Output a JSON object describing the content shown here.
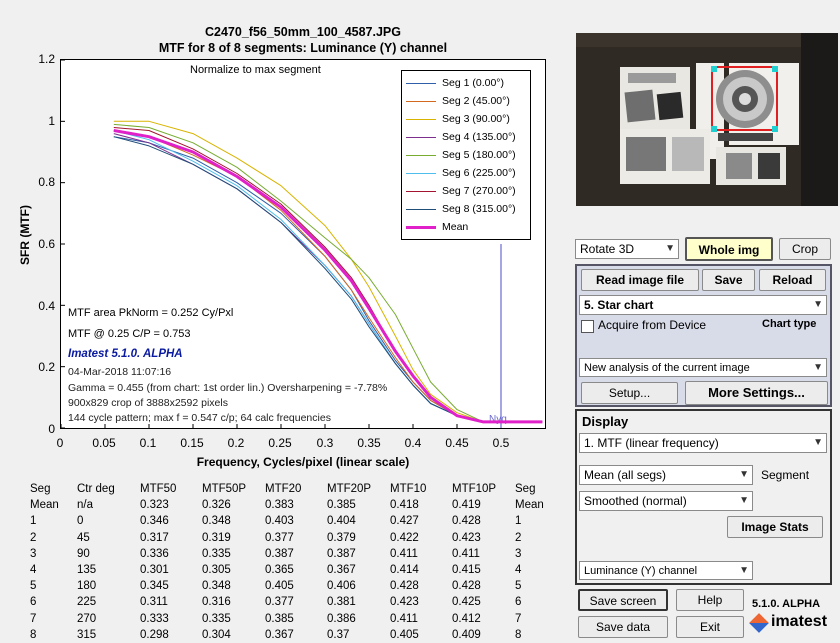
{
  "chart_data": {
    "type": "line",
    "title": "C2470_f56_50mm_100_4587.JPG",
    "subtitle": "MTF for 8 of 8 segments:  Luminance (Y) channel",
    "xlabel": "Frequency, Cycles/pixel (linear scale)",
    "ylabel": "SFR (MTF)",
    "xlim": [
      0,
      0.55
    ],
    "ylim": [
      0,
      1.2
    ],
    "x_ticks": [
      "0",
      "0.05",
      "0.1",
      "0.15",
      "0.2",
      "0.25",
      "0.3",
      "0.35",
      "0.4",
      "0.45",
      "0.5"
    ],
    "y_ticks": [
      "0",
      "0.2",
      "0.4",
      "0.6",
      "0.8",
      "1",
      "1.2"
    ],
    "top_note": "Normalize to max segment",
    "nyquist_label": "Nyq",
    "nyquist_x": 0.5,
    "legend_placement": "top-right",
    "x": [
      0.06,
      0.1,
      0.15,
      0.2,
      0.25,
      0.3,
      0.33,
      0.35,
      0.38,
      0.4,
      0.42,
      0.45,
      0.48,
      0.5,
      0.547
    ],
    "series": [
      {
        "name": "Seg 1 (0.00°)",
        "color": "#2e5fa8",
        "values": [
          0.95,
          0.93,
          0.88,
          0.8,
          0.7,
          0.56,
          0.45,
          0.35,
          0.22,
          0.15,
          0.09,
          0.04,
          0.02,
          0.02,
          0.02
        ]
      },
      {
        "name": "Seg 2 (45.00°)",
        "color": "#d2691e",
        "values": [
          0.97,
          0.95,
          0.89,
          0.82,
          0.71,
          0.56,
          0.45,
          0.36,
          0.23,
          0.15,
          0.09,
          0.04,
          0.02,
          0.02,
          0.02
        ]
      },
      {
        "name": "Seg 3 (90.00°)",
        "color": "#d8b400",
        "values": [
          1.0,
          1.0,
          0.96,
          0.88,
          0.79,
          0.66,
          0.55,
          0.46,
          0.3,
          0.19,
          0.11,
          0.05,
          0.02,
          0.02,
          0.02
        ]
      },
      {
        "name": "Seg 4 (135.00°)",
        "color": "#7e2f8e",
        "values": [
          0.96,
          0.93,
          0.86,
          0.78,
          0.67,
          0.53,
          0.43,
          0.34,
          0.21,
          0.14,
          0.08,
          0.04,
          0.02,
          0.02,
          0.02
        ]
      },
      {
        "name": "Seg 5 (180.00°)",
        "color": "#77ac30",
        "values": [
          0.99,
          0.98,
          0.93,
          0.85,
          0.74,
          0.62,
          0.55,
          0.49,
          0.37,
          0.26,
          0.15,
          0.06,
          0.02,
          0.02,
          0.02
        ]
      },
      {
        "name": "Seg 6 (225.00°)",
        "color": "#4dbeee",
        "values": [
          0.97,
          0.94,
          0.87,
          0.79,
          0.68,
          0.53,
          0.43,
          0.34,
          0.21,
          0.14,
          0.08,
          0.04,
          0.02,
          0.02,
          0.02
        ]
      },
      {
        "name": "Seg 7 (270.00°)",
        "color": "#a2142f",
        "values": [
          0.98,
          0.97,
          0.91,
          0.83,
          0.73,
          0.59,
          0.49,
          0.4,
          0.25,
          0.17,
          0.1,
          0.04,
          0.02,
          0.02,
          0.02
        ]
      },
      {
        "name": "Seg 8 (315.00°)",
        "color": "#1f4e79",
        "values": [
          0.95,
          0.92,
          0.86,
          0.78,
          0.67,
          0.52,
          0.42,
          0.33,
          0.21,
          0.14,
          0.08,
          0.04,
          0.02,
          0.02,
          0.02
        ]
      },
      {
        "name": "Mean",
        "color": "#e020c8",
        "values": [
          0.97,
          0.95,
          0.9,
          0.82,
          0.72,
          0.58,
          0.48,
          0.39,
          0.25,
          0.17,
          0.1,
          0.04,
          0.02,
          0.02,
          0.02
        ]
      }
    ]
  },
  "annotations": {
    "mtf_area": "MTF area PkNorm = 0.252 Cy/Pxl",
    "mtf_at": "MTF @ 0.25 C/P = 0.753",
    "version_label": "Imatest 5.1.0. ALPHA",
    "date": "04-Mar-2018 11:07:16",
    "gamma": "Gamma = 0.455 (from chart: 1st order lin.)  Oversharpening = -7.78%",
    "crop": "900x829 crop of 3888x2592 pixels",
    "cycle": "144 cycle pattern; max f = 0.547 c/p;  64 calc frequencies"
  },
  "results_table": {
    "headers": [
      "Seg",
      "Ctr deg",
      "MTF50",
      "MTF50P",
      "MTF20",
      "MTF20P",
      "MTF10",
      "MTF10P",
      "Seg"
    ],
    "rows": [
      [
        "Mean",
        "n/a",
        "0.323",
        "0.326",
        "0.383",
        "0.385",
        "0.418",
        "0.419",
        "Mean"
      ],
      [
        "1",
        "0",
        "0.346",
        "0.348",
        "0.403",
        "0.404",
        "0.427",
        "0.428",
        "1"
      ],
      [
        "2",
        "45",
        "0.317",
        "0.319",
        "0.377",
        "0.379",
        "0.422",
        "0.423",
        "2"
      ],
      [
        "3",
        "90",
        "0.336",
        "0.335",
        "0.387",
        "0.387",
        "0.411",
        "0.411",
        "3"
      ],
      [
        "4",
        "135",
        "0.301",
        "0.305",
        "0.365",
        "0.367",
        "0.414",
        "0.415",
        "4"
      ],
      [
        "5",
        "180",
        "0.345",
        "0.348",
        "0.405",
        "0.406",
        "0.428",
        "0.428",
        "5"
      ],
      [
        "6",
        "225",
        "0.311",
        "0.316",
        "0.377",
        "0.381",
        "0.423",
        "0.425",
        "6"
      ],
      [
        "7",
        "270",
        "0.333",
        "0.335",
        "0.385",
        "0.386",
        "0.411",
        "0.412",
        "7"
      ],
      [
        "8",
        "315",
        "0.298",
        "0.304",
        "0.367",
        "0.37",
        "0.405",
        "0.409",
        "8"
      ]
    ]
  },
  "controls": {
    "rotate_select": "Rotate 3D",
    "whole_img_button": "Whole img",
    "crop_button": "Crop",
    "read_image_button": "Read image file",
    "save_button": "Save",
    "reload_button": "Reload",
    "chart_select": "5. Star chart",
    "acquire_label": "Acquire from Device",
    "chart_type_label": "Chart type",
    "analysis_select": "New analysis of the current image",
    "setup_button": "Setup...",
    "more_settings_button": "More Settings...",
    "display_label": "Display",
    "display_select": "1. MTF (linear frequency)",
    "segment_select": "Mean (all segs)",
    "segment_label": "Segment",
    "smoothing_select": "Smoothed (normal)",
    "image_stats_button": "Image Stats",
    "channel_select": "Luminance (Y) channel",
    "save_screen_button": "Save screen",
    "help_button": "Help",
    "save_data_button": "Save data",
    "exit_button": "Exit",
    "version": "5.1.0. ALPHA",
    "brand": "imatest"
  },
  "colors": {
    "whole_img_bg": "#ffffcc",
    "plot_bg": "#ffffff",
    "window_bg": "#f0f0f0",
    "mean_line": "#e020c8",
    "nyquist_line": "#6a6ad0"
  }
}
